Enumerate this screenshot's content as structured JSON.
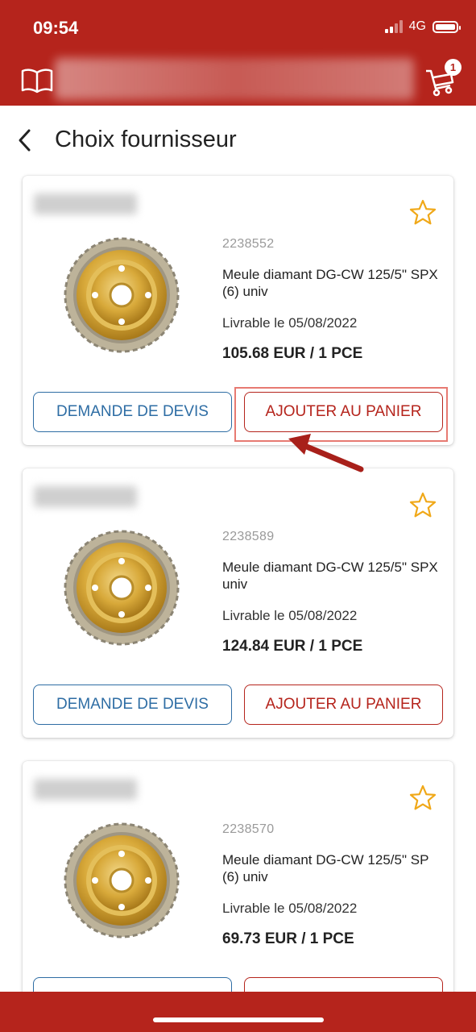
{
  "status_bar": {
    "time": "09:54",
    "network": "4G"
  },
  "header": {
    "cart_count": "1"
  },
  "page": {
    "title": "Choix fournisseur"
  },
  "colors": {
    "brand_red": "#b5241c",
    "quote_blue": "#2e6da4",
    "star_gold": "#f0a818"
  },
  "products": [
    {
      "ref": "2238552",
      "name": "Meule diamant DG-CW 125/5\" SPX (6) univ",
      "delivery": "Livrable le 05/08/2022",
      "price": "105.68 EUR / 1 PCE",
      "quote_label": "DEMANDE DE DEVIS",
      "cart_label": "AJOUTER AU PANIER"
    },
    {
      "ref": "2238589",
      "name": "Meule diamant DG-CW 125/5\" SPX univ",
      "delivery": "Livrable le 05/08/2022",
      "price": "124.84 EUR / 1 PCE",
      "quote_label": "DEMANDE DE DEVIS",
      "cart_label": "AJOUTER AU PANIER"
    },
    {
      "ref": "2238570",
      "name": "Meule diamant DG-CW 125/5\" SP (6) univ",
      "delivery": "Livrable le 05/08/2022",
      "price": "69.73 EUR / 1 PCE",
      "quote_label": "",
      "cart_label": ""
    }
  ]
}
